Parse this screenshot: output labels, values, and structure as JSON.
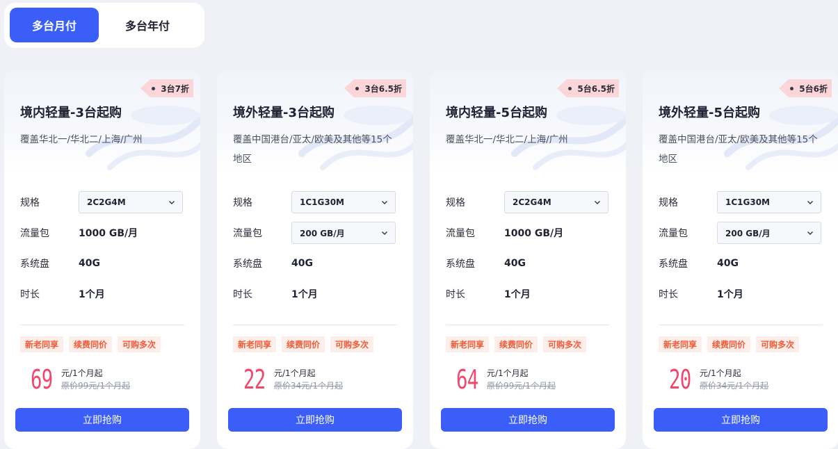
{
  "tabs": {
    "monthly": "多台月付",
    "yearly": "多台年付"
  },
  "labels": {
    "spec": "规格",
    "traffic": "流量包",
    "disk": "系统盘",
    "duration": "时长",
    "buy": "立即抢购"
  },
  "cards": [
    {
      "discount": "3台7折",
      "title": "境内轻量-3台起购",
      "subtitle": "覆盖华北一/华北二/上海/广州",
      "spec": "2C2G4M",
      "traffic": "1000 GB/月",
      "traffic_is_select": false,
      "disk": "40G",
      "duration": "1个月",
      "tags": [
        "新老同享",
        "续费同价",
        "可购多次"
      ],
      "price": "69",
      "unit": "元/1个月起",
      "original": "原价99元/1个月起"
    },
    {
      "discount": "3台6.5折",
      "title": "境外轻量-3台起购",
      "subtitle": "覆盖中国港台/亚太/欧美及其他等15个地区",
      "spec": "1C1G30M",
      "traffic": "200 GB/月",
      "traffic_is_select": true,
      "disk": "40G",
      "duration": "1个月",
      "tags": [
        "新老同享",
        "续费同价",
        "可购多次"
      ],
      "price": "22",
      "unit": "元/1个月起",
      "original": "原价34元/1个月起"
    },
    {
      "discount": "5台6.5折",
      "title": "境内轻量-5台起购",
      "subtitle": "覆盖华北一/华北二/上海/广州",
      "spec": "2C2G4M",
      "traffic": "1000 GB/月",
      "traffic_is_select": false,
      "disk": "40G",
      "duration": "1个月",
      "tags": [
        "新老同享",
        "续费同价",
        "可购多次"
      ],
      "price": "64",
      "unit": "元/1个月起",
      "original": "原价99元/1个月起"
    },
    {
      "discount": "5台6折",
      "title": "境外轻量-5台起购",
      "subtitle": "覆盖中国港台/亚太/欧美及其他等15个地区",
      "spec": "1C1G30M",
      "traffic": "200 GB/月",
      "traffic_is_select": true,
      "disk": "40G",
      "duration": "1个月",
      "tags": [
        "新老同享",
        "续费同价",
        "可购多次"
      ],
      "price": "20",
      "unit": "元/1个月起",
      "original": "原价34元/1个月起"
    }
  ],
  "colors": {
    "accent": "#3c5ef8",
    "price": "#f0486c",
    "tag_text": "#f25a38",
    "tag_bg": "#fdeee9",
    "ribbon": "#fbd6d9"
  },
  "icons": {
    "dropdown": "chevron-down-icon",
    "ribbon_dot": "dot-icon"
  }
}
